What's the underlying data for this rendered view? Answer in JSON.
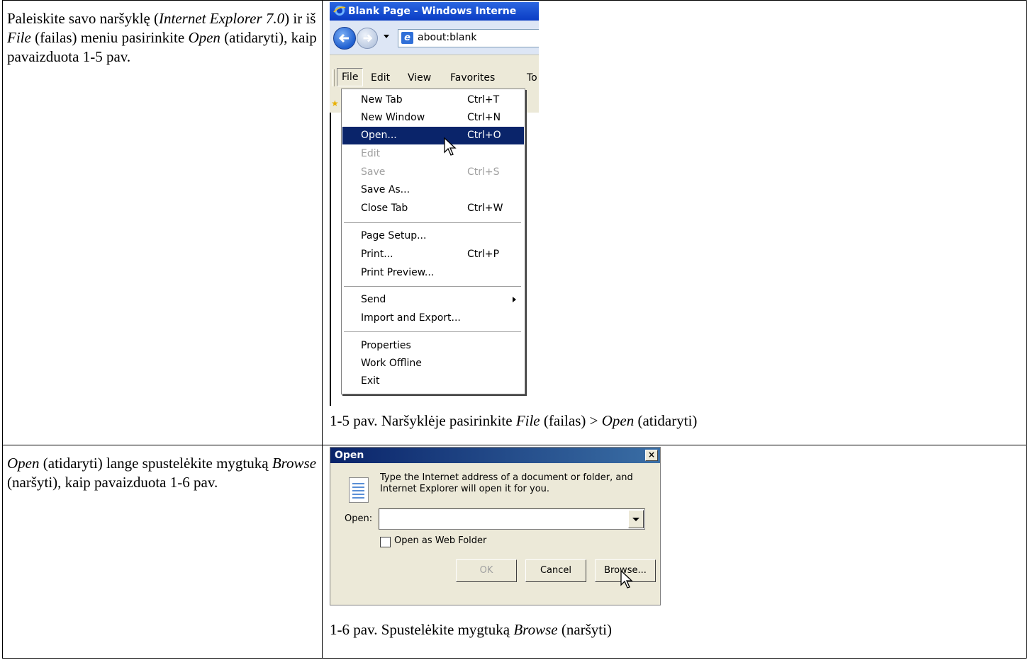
{
  "row1": {
    "instruction": {
      "p1": "Paleiskite savo naršyklę (",
      "i1": "Internet Explorer 7.0",
      "p2": ") ir iš ",
      "i2": "File",
      "p3": " (failas) meniu pasirinkite ",
      "i3": "Open",
      "p4": " (atidaryti), kaip pavaizduota 1-5 pav."
    },
    "screenshot": {
      "window_title": "Blank Page - Windows Interne",
      "address": "about:blank",
      "menubar": [
        "File",
        "Edit",
        "View",
        "Favorites",
        "To"
      ],
      "file_menu": [
        {
          "label": "New Tab",
          "shortcut": "Ctrl+T"
        },
        {
          "label": "New Window",
          "shortcut": "Ctrl+N"
        },
        {
          "label": "Open...",
          "shortcut": "Ctrl+O"
        },
        {
          "label": "Edit",
          "shortcut": ""
        },
        {
          "label": "Save",
          "shortcut": "Ctrl+S"
        },
        {
          "label": "Save As...",
          "shortcut": ""
        },
        {
          "label": "Close Tab",
          "shortcut": "Ctrl+W"
        },
        {
          "label": "Page Setup...",
          "shortcut": ""
        },
        {
          "label": "Print...",
          "shortcut": "Ctrl+P"
        },
        {
          "label": "Print Preview...",
          "shortcut": ""
        },
        {
          "label": "Send",
          "shortcut": ""
        },
        {
          "label": "Import and Export...",
          "shortcut": ""
        },
        {
          "label": "Properties",
          "shortcut": ""
        },
        {
          "label": "Work Offline",
          "shortcut": ""
        },
        {
          "label": "Exit",
          "shortcut": ""
        }
      ],
      "selected_item": "Open...",
      "disabled_items": [
        "Edit",
        "Save"
      ]
    },
    "caption": {
      "p1": "1-5 pav. Naršyklėje pasirinkite ",
      "i1": "File",
      "p2": " (failas) > ",
      "i2": "Open",
      "p3": " (atidaryti)"
    }
  },
  "row2": {
    "instruction": {
      "i1": "Open",
      "p1": " (atidaryti) lange spustelėkite mygtuką ",
      "i2": "Browse",
      "p2": " (naršyti), kaip pavaizduota 1-6 pav."
    },
    "dialog": {
      "title": "Open",
      "close": "×",
      "message": "Type the Internet address of a document or folder, and Internet Explorer will open it for you.",
      "open_label": "Open:",
      "open_value": "",
      "checkbox_label": "Open as Web Folder",
      "ok": "OK",
      "cancel": "Cancel",
      "browse": "Browse..."
    },
    "caption": {
      "p1": "1-6 pav. Spustelėkite mygtuką ",
      "i1": "Browse",
      "p2": " (naršyti)"
    }
  }
}
